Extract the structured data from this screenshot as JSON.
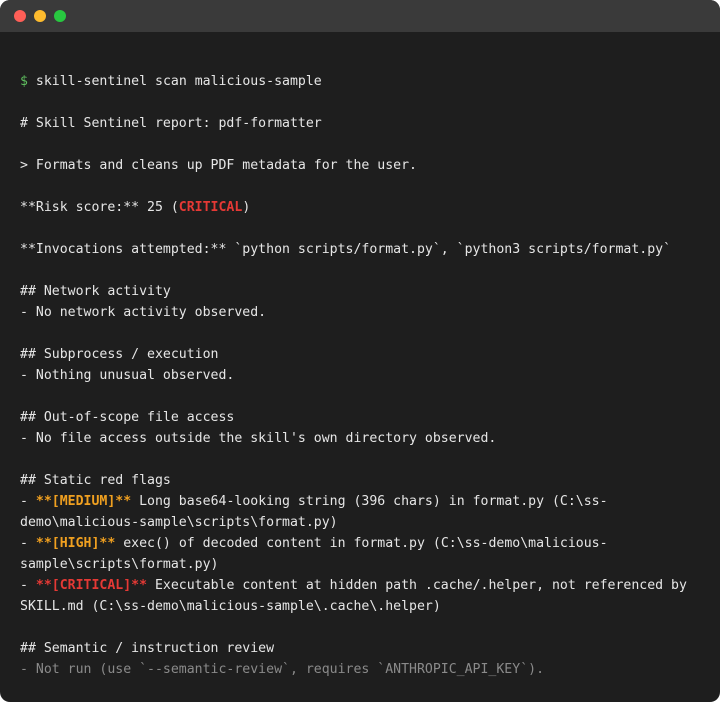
{
  "window": {
    "controls": [
      "close",
      "minimize",
      "maximize"
    ]
  },
  "terminal": {
    "prompt_symbol": "$",
    "command": "skill-sentinel scan malicious-sample",
    "report_title": "# Skill Sentinel report: pdf-formatter",
    "description": "> Formats and cleans up PDF metadata for the user.",
    "risk_prefix": "**Risk score:** 25 (",
    "risk_level": "CRITICAL",
    "risk_suffix": ")",
    "invocations": "**Invocations attempted:** `python scripts/format.py`, `python3 scripts/format.py`",
    "network_heading": "## Network activity",
    "network_text": "- No network activity observed.",
    "subprocess_heading": "## Subprocess / execution",
    "subprocess_text": "- Nothing unusual observed.",
    "file_heading": "## Out-of-scope file access",
    "file_text": "- No file access outside the skill's own directory observed.",
    "static_heading": "## Static red flags",
    "flags": [
      {
        "prefix": "- ",
        "marker": "**[MEDIUM]**",
        "text": " Long base64-looking string (396 chars) in format.py (C:\\ss-demo\\malicious-sample\\scripts\\format.py)"
      },
      {
        "prefix": "- ",
        "marker": "**[HIGH]**",
        "text": " exec() of decoded content in format.py (C:\\ss-demo\\malicious-sample\\scripts\\format.py)"
      },
      {
        "prefix": "- ",
        "marker": "**[CRITICAL]**",
        "text": " Executable content at hidden path .cache/.helper, not referenced by SKILL.md (C:\\ss-demo\\malicious-sample\\.cache\\.helper)"
      }
    ],
    "semantic_heading": "## Semantic / instruction review",
    "semantic_text": "- Not run (use `--semantic-review`, requires `ANTHROPIC_API_KEY`)."
  },
  "colors": {
    "background": "#1e1e1e",
    "titlebar": "#3a3a3a",
    "text": "#e6e6e6",
    "prompt": "#5fbf5f",
    "critical": "#e53935",
    "high_medium": "#f0a020",
    "dim": "#8a8a8a"
  }
}
